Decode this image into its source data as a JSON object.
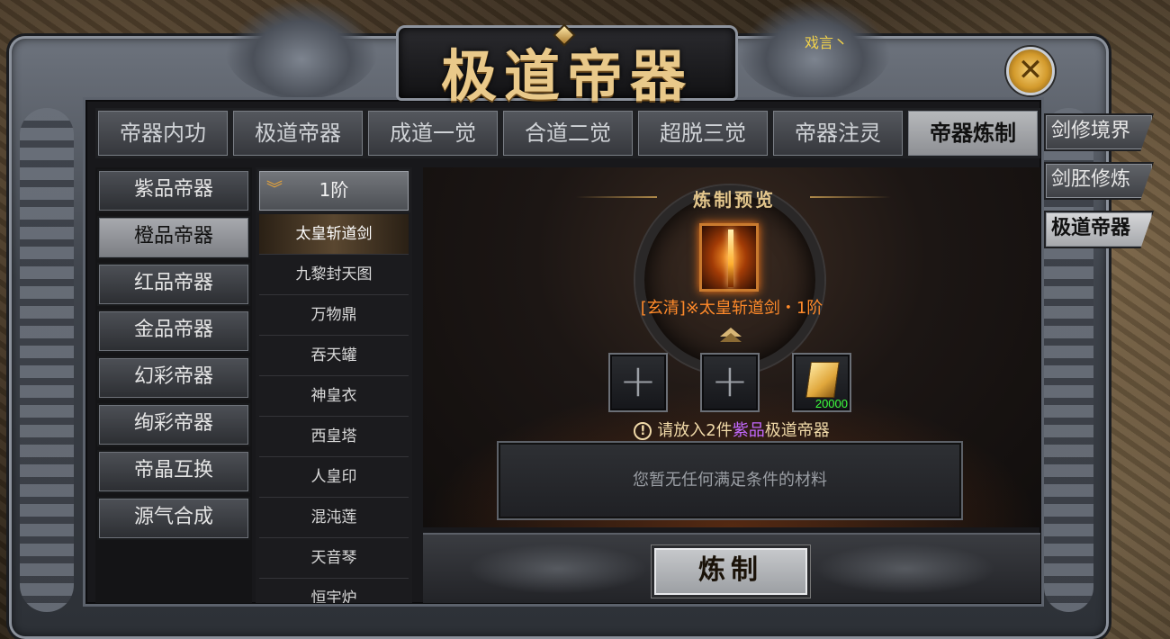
{
  "title": "极道帝器",
  "server_note": "戏言丶",
  "top_tabs": [
    {
      "label": "帝器内功"
    },
    {
      "label": "极道帝器"
    },
    {
      "label": "成道一觉"
    },
    {
      "label": "合道二觉"
    },
    {
      "label": "超脱三觉"
    },
    {
      "label": "帝器注灵"
    },
    {
      "label": "帝器炼制",
      "active": true
    }
  ],
  "side_tabs": [
    {
      "label": "剑修境界"
    },
    {
      "label": "剑胚修炼"
    },
    {
      "label": "极道帝器",
      "active": true
    }
  ],
  "categories": [
    {
      "label": "紫品帝器"
    },
    {
      "label": "橙品帝器",
      "active": true
    },
    {
      "label": "红品帝器"
    },
    {
      "label": "金品帝器"
    },
    {
      "label": "幻彩帝器"
    },
    {
      "label": "绚彩帝器"
    },
    {
      "label": "帝晶互换"
    },
    {
      "label": "源气合成"
    }
  ],
  "tier_header": "1阶",
  "items": [
    {
      "label": "太皇斩道剑",
      "active": true
    },
    {
      "label": "九黎封天图"
    },
    {
      "label": "万物鼎"
    },
    {
      "label": "吞天罐"
    },
    {
      "label": "神皇衣"
    },
    {
      "label": "西皇塔"
    },
    {
      "label": "人皇印"
    },
    {
      "label": "混沌莲"
    },
    {
      "label": "天音琴"
    },
    {
      "label": "恒宇炉"
    }
  ],
  "preview": {
    "title": "炼制预览",
    "result_name": "[玄清]※太皇斩道剑・1阶",
    "slot_symbol": "+",
    "token_qty": "20000",
    "hint_prefix": "请放入2件",
    "hint_grade": "紫品",
    "hint_suffix": "极道帝器",
    "hint_icon": "!",
    "empty_materials": "您暂无任何满足条件的材料"
  },
  "refine_button": "炼制",
  "colors": {
    "accent_gold": "#e9c98a",
    "result_orange": "#ff8a2a",
    "grade_purple": "#c468ff",
    "qty_green": "#3cff3c"
  }
}
